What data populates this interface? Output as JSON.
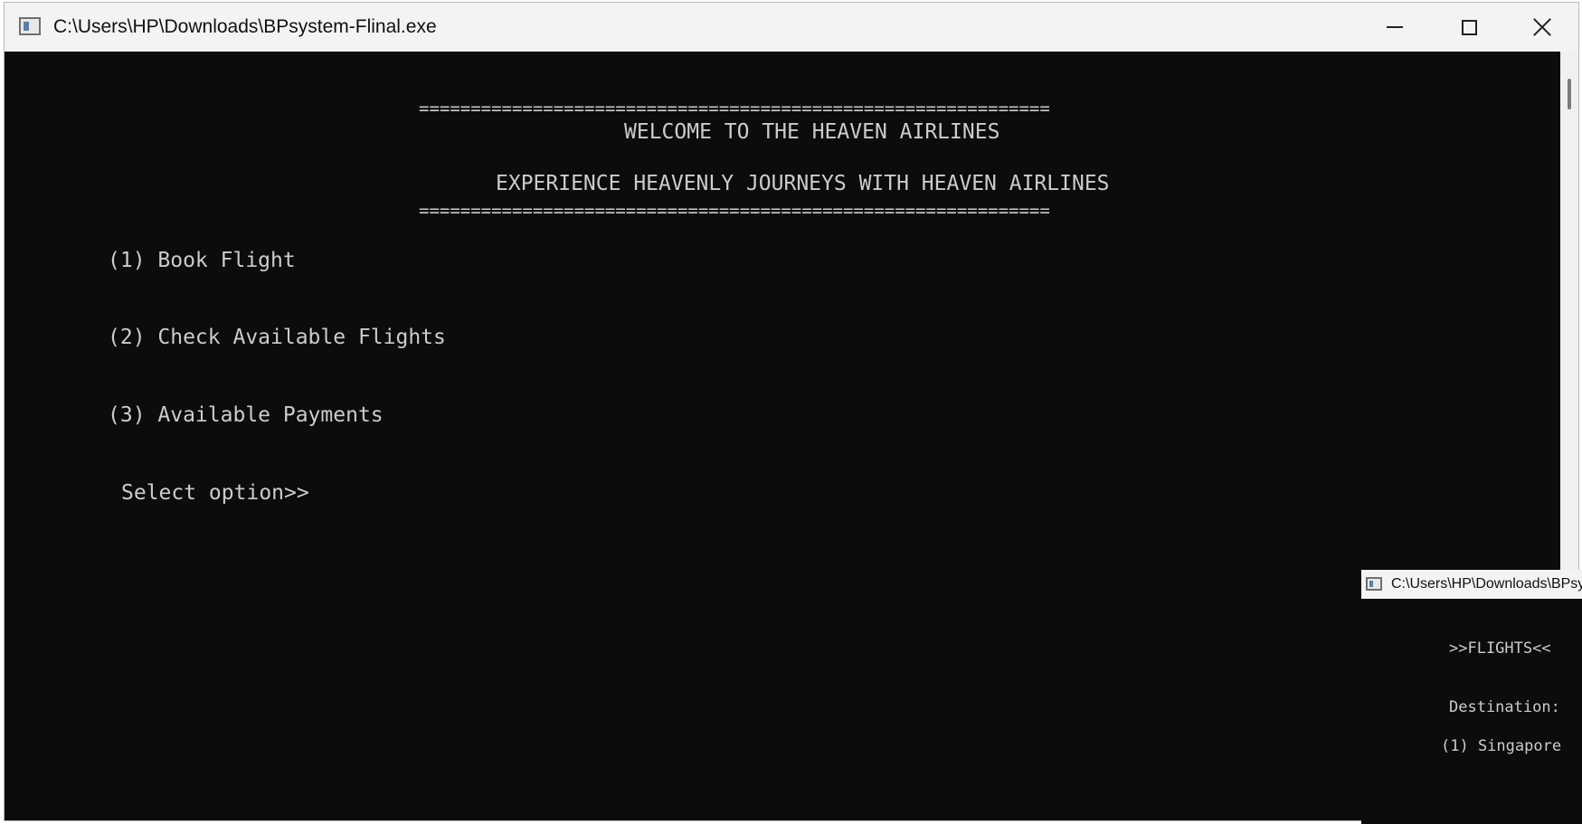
{
  "window": {
    "title": "C:\\Users\\HP\\Downloads\\BPsystem-Flinal.exe",
    "icon": "console-app-icon",
    "controls": [
      "minimize-icon",
      "maximize-icon",
      "close-icon"
    ]
  },
  "console": {
    "border_top": "=============================================================",
    "welcome": "WELCOME TO THE HEAVEN AIRLINES",
    "tagline": "EXPERIENCE HEAVENLY JOURNEYS WITH HEAVEN AIRLINES",
    "border_bottom": "=============================================================",
    "options": [
      "(1) Book Flight",
      "(2) Check Available Flights",
      "(3) Available Payments"
    ],
    "prompt": "Select option>>"
  },
  "second_window": {
    "title": "C:\\Users\\HP\\Downloads\\BPsy",
    "heading": ">>FLIGHTS<<",
    "destination_label": "Destination:",
    "destination_item": "(1) Singapore"
  },
  "colors": {
    "console_bg": "#0c0c0c",
    "console_text": "#cccccc",
    "titlebar_bg": "#f3f3f3"
  }
}
